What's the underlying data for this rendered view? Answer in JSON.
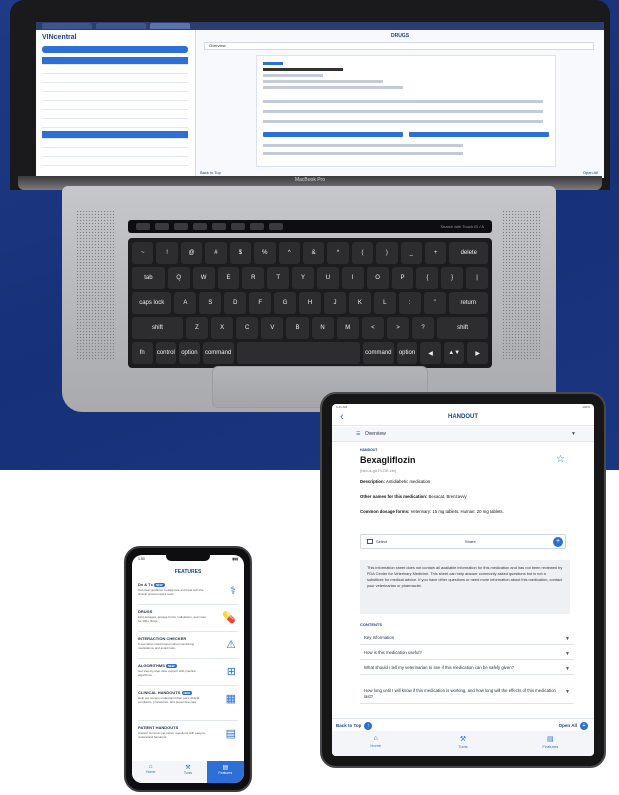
{
  "colors": {
    "brand_blue": "#1d3f8f",
    "accent": "#2c6fd6",
    "background_top": "#1f3a86"
  },
  "laptop": {
    "hinge_label": "MacBook Pro",
    "touchbar_text": "Search with Touch ID / A",
    "screen": {
      "logo": "VINcentral",
      "title": "DRUGS",
      "overview_label": "Overview",
      "back_to_top": "Back to Top",
      "open_all": "Open All"
    },
    "keyboard": {
      "row1": [
        "~",
        "!",
        "@",
        "#",
        "$",
        "%",
        "^",
        "&",
        "*",
        "(",
        ")",
        "_",
        "+",
        "delete"
      ],
      "row2": [
        "tab",
        "Q",
        "W",
        "E",
        "R",
        "T",
        "Y",
        "U",
        "I",
        "O",
        "P",
        "{",
        "}",
        "|"
      ],
      "row3": [
        "caps lock",
        "A",
        "S",
        "D",
        "F",
        "G",
        "H",
        "J",
        "K",
        "L",
        ":",
        "\"",
        "return"
      ],
      "row4": [
        "shift",
        "Z",
        "X",
        "C",
        "V",
        "B",
        "N",
        "M",
        "<",
        ">",
        "?",
        "shift"
      ],
      "row5": [
        "fn",
        "control",
        "option",
        "command",
        "",
        "command",
        "option",
        "◀",
        "▲▼",
        "▶"
      ]
    }
  },
  "tablet": {
    "header_title": "HANDOUT",
    "overview": "Overview",
    "section_label": "HANDOUT",
    "drug_name": "Bexagliflozin",
    "pronunciation": "(bex-a-gli-FLOE-zin)",
    "description_label": "Description:",
    "description_value": "Antidiabetic medication",
    "other_names_label": "Other names for this medication:",
    "other_names_value": "Bexacat, Brenzavvy",
    "dosage_label": "Common dosage forms:",
    "dosage_value": "Veterinary: 15 mg tablets. Human: 20 mg tablets.",
    "select_label": "Select",
    "share_label": "Share",
    "disclaimer": "This information sheet does not contain all available information for this medication and has not been reviewed by FDA Center for Veterinary Medicine. This sheet can help answer commonly asked questions but is not a substitute for medical advice. If you have other questions or need more information about this medication, contact your veterinarian or pharmacist.",
    "contents_label": "CONTENTS",
    "contents": [
      "Key Information",
      "How is this medication useful?",
      "What should I tell my veterinarian to see if this medication can be safely given?",
      "How long until I will know if this medication is working, and how long will the effects of this medication last?"
    ],
    "back_to_top": "Back to Top",
    "open_all": "Open All",
    "nav": [
      "Home",
      "Tools",
      "Features"
    ]
  },
  "phone": {
    "status_time": "1:50",
    "title": "FEATURES",
    "items": [
      {
        "title": "Dx & Tx",
        "badge": "NEW",
        "desc": "Get clear guidance to diagnose and treat with the clinical protocol quick tools."
      },
      {
        "title": "DRUGS",
        "badge": "",
        "desc": "Find dosages, dosage forms, indications, and more for 400+ drugs."
      },
      {
        "title": "INTERACTION CHECKER",
        "badge": "",
        "desc": "Know what could happen when combining medications and avoid risks."
      },
      {
        "title": "ALGORITHMS",
        "badge": "NEW",
        "desc": "Get step-by-step case support with practice algorithms."
      },
      {
        "title": "CLINICAL HANDOUTS",
        "badge": "NEW",
        "desc": "Help pet owners understand their pet's clinical conditions, procedures, and preventive care."
      },
      {
        "title": "PATIENT HANDOUTS",
        "badge": "",
        "desc": "Answer common pet owner questions with easy-to-understand handouts."
      }
    ],
    "nav": [
      "Home",
      "Tools",
      "Features"
    ]
  }
}
